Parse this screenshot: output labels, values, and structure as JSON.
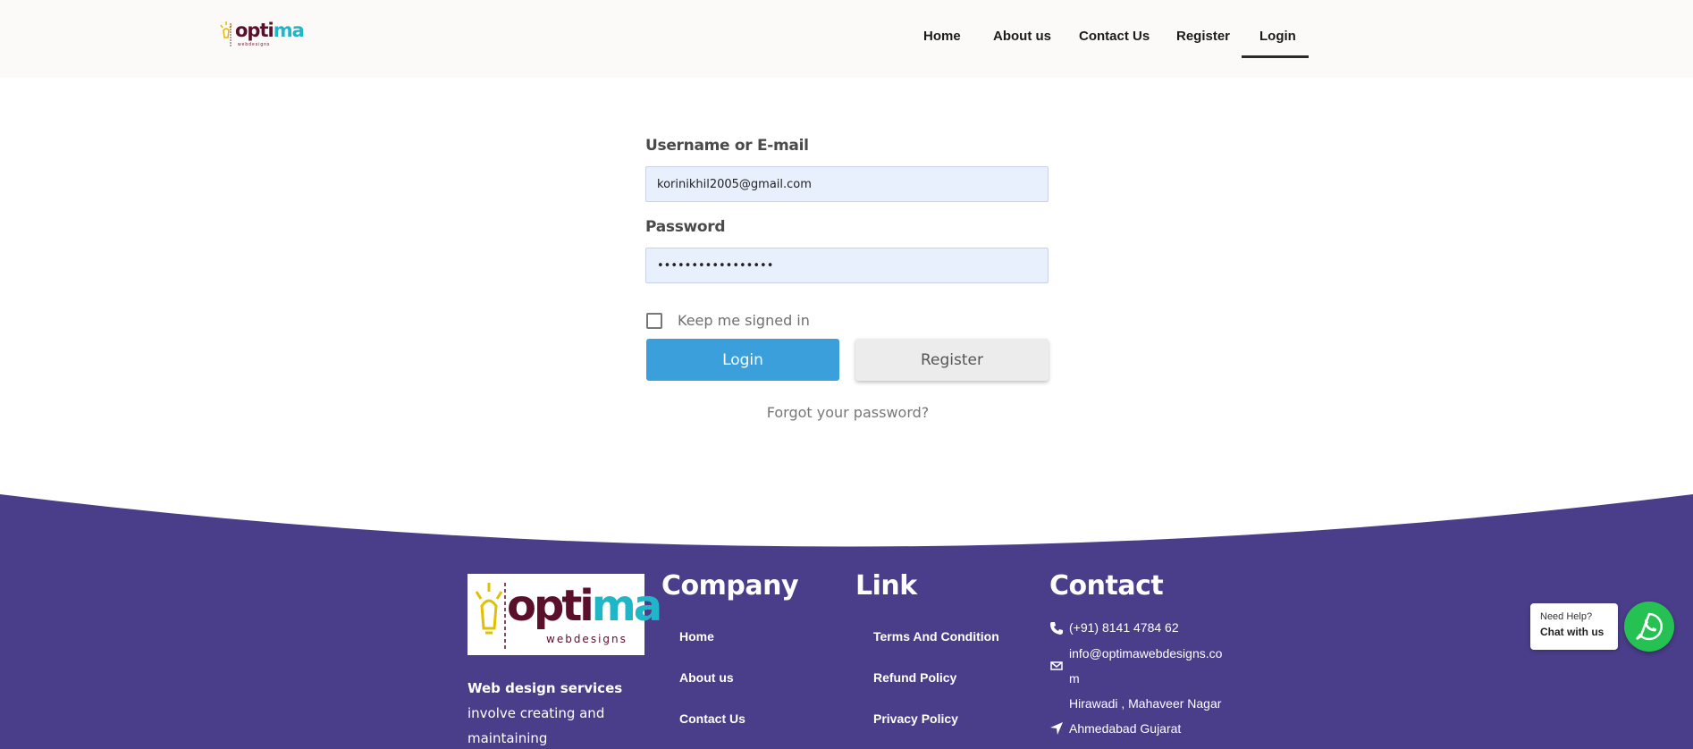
{
  "brand": {
    "name_part1": "opti",
    "name_part2": "ma",
    "tagline": "webdesigns"
  },
  "nav": {
    "items": [
      {
        "label": "Home"
      },
      {
        "label": "About us"
      },
      {
        "label": "Contact Us"
      },
      {
        "label": "Register"
      },
      {
        "label": "Login",
        "active": true
      }
    ]
  },
  "form": {
    "username_label": "Username or E-mail",
    "username_value": "korinikhil2005@gmail.com",
    "password_label": "Password",
    "password_value": "•••••••••••••••••",
    "remember_label": "Keep me signed in",
    "login_label": "Login",
    "register_label": "Register",
    "forgot_label": "Forgot your password?"
  },
  "footer": {
    "about_bold": "Web design services",
    "about_text": " involve creating and maintaining responsive,",
    "company": {
      "title": "Company",
      "links": [
        "Home",
        "About us",
        "Contact Us"
      ]
    },
    "link": {
      "title": "Link",
      "links": [
        "Terms And Condition",
        "Refund Policy",
        "Privacy Policy"
      ]
    },
    "contact": {
      "title": "Contact",
      "phone": "(+91) 8141 4784 62",
      "email_line1": "info@optimawebdesigns.co",
      "email_line2": "m",
      "address_line1": "Hirawadi , Mahaveer Nagar",
      "address_line2": "Ahmedabad Gujarat"
    }
  },
  "chat": {
    "need_help": "Need Help?",
    "chat_with_us": "Chat with us"
  },
  "colors": {
    "footer_bg": "#4a3d89",
    "login_button": "#3b9fdc",
    "whatsapp": "#25c152",
    "brand_dark": "#5a0f2a",
    "brand_teal": "#1fb7c7"
  }
}
